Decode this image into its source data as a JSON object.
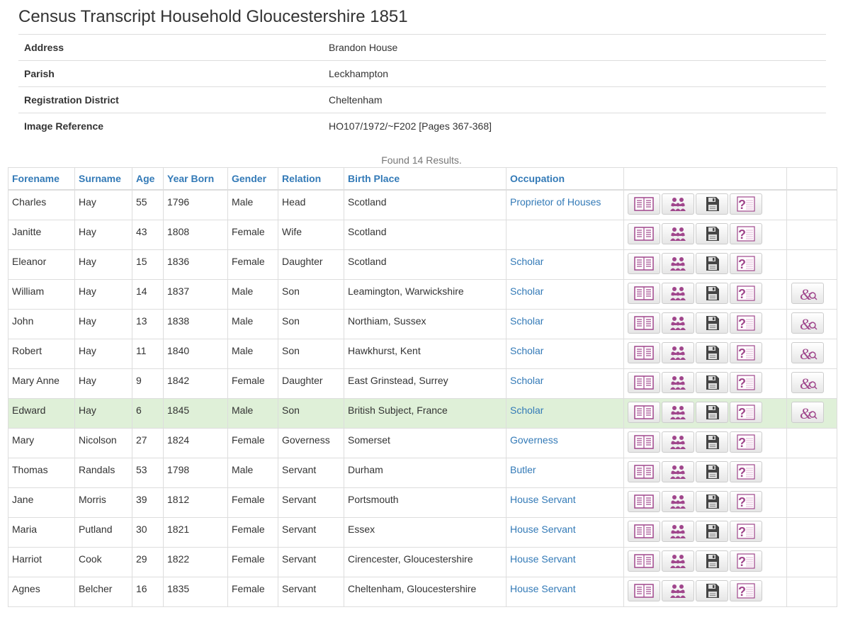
{
  "title": "Census Transcript Household Gloucestershire 1851",
  "info": [
    {
      "key": "Address",
      "value": "Brandon House"
    },
    {
      "key": "Parish",
      "value": "Leckhampton"
    },
    {
      "key": "Registration District",
      "value": "Cheltenham"
    },
    {
      "key": "Image Reference",
      "value": "HO107/1972/~F202 [Pages 367-368]"
    }
  ],
  "found_text": "Found 14 Results.",
  "columns": [
    "Forename",
    "Surname",
    "Age",
    "Year Born",
    "Gender",
    "Relation",
    "Birth Place",
    "Occupation"
  ],
  "icon_color": "#a0468c",
  "highlight_color": "#dff0d8",
  "rows": [
    {
      "forename": "Charles",
      "surname": "Hay",
      "age": "55",
      "born": "1796",
      "gender": "Male",
      "relation": "Head",
      "birthplace": "Scotland",
      "occupation": "Proprietor of Houses",
      "extra": false,
      "highlight": false
    },
    {
      "forename": "Janitte",
      "surname": "Hay",
      "age": "43",
      "born": "1808",
      "gender": "Female",
      "relation": "Wife",
      "birthplace": "Scotland",
      "occupation": "",
      "extra": false,
      "highlight": false
    },
    {
      "forename": "Eleanor",
      "surname": "Hay",
      "age": "15",
      "born": "1836",
      "gender": "Female",
      "relation": "Daughter",
      "birthplace": "Scotland",
      "occupation": "Scholar",
      "extra": false,
      "highlight": false
    },
    {
      "forename": "William",
      "surname": "Hay",
      "age": "14",
      "born": "1837",
      "gender": "Male",
      "relation": "Son",
      "birthplace": "Leamington, Warwickshire",
      "occupation": "Scholar",
      "extra": true,
      "highlight": false
    },
    {
      "forename": "John",
      "surname": "Hay",
      "age": "13",
      "born": "1838",
      "gender": "Male",
      "relation": "Son",
      "birthplace": "Northiam, Sussex",
      "occupation": "Scholar",
      "extra": true,
      "highlight": false
    },
    {
      "forename": "Robert",
      "surname": "Hay",
      "age": "11",
      "born": "1840",
      "gender": "Male",
      "relation": "Son",
      "birthplace": "Hawkhurst, Kent",
      "occupation": "Scholar",
      "extra": true,
      "highlight": false
    },
    {
      "forename": "Mary Anne",
      "surname": "Hay",
      "age": "9",
      "born": "1842",
      "gender": "Female",
      "relation": "Daughter",
      "birthplace": "East Grinstead, Surrey",
      "occupation": "Scholar",
      "extra": true,
      "highlight": false
    },
    {
      "forename": "Edward",
      "surname": "Hay",
      "age": "6",
      "born": "1845",
      "gender": "Male",
      "relation": "Son",
      "birthplace": "British Subject, France",
      "occupation": "Scholar",
      "extra": true,
      "highlight": true
    },
    {
      "forename": "Mary",
      "surname": "Nicolson",
      "age": "27",
      "born": "1824",
      "gender": "Female",
      "relation": "Governess",
      "birthplace": "Somerset",
      "occupation": "Governess",
      "extra": false,
      "highlight": false
    },
    {
      "forename": "Thomas",
      "surname": "Randals",
      "age": "53",
      "born": "1798",
      "gender": "Male",
      "relation": "Servant",
      "birthplace": "Durham",
      "occupation": "Butler",
      "extra": false,
      "highlight": false
    },
    {
      "forename": "Jane",
      "surname": "Morris",
      "age": "39",
      "born": "1812",
      "gender": "Female",
      "relation": "Servant",
      "birthplace": "Portsmouth",
      "occupation": "House Servant",
      "extra": false,
      "highlight": false
    },
    {
      "forename": "Maria",
      "surname": "Putland",
      "age": "30",
      "born": "1821",
      "gender": "Female",
      "relation": "Servant",
      "birthplace": "Essex",
      "occupation": "House Servant",
      "extra": false,
      "highlight": false
    },
    {
      "forename": "Harriot",
      "surname": "Cook",
      "age": "29",
      "born": "1822",
      "gender": "Female",
      "relation": "Servant",
      "birthplace": "Cirencester, Gloucestershire",
      "occupation": "House Servant",
      "extra": false,
      "highlight": false
    },
    {
      "forename": "Agnes",
      "surname": "Belcher",
      "age": "16",
      "born": "1835",
      "gender": "Female",
      "relation": "Servant",
      "birthplace": "Cheltenham, Gloucestershire",
      "occupation": "House Servant",
      "extra": false,
      "highlight": false
    }
  ]
}
